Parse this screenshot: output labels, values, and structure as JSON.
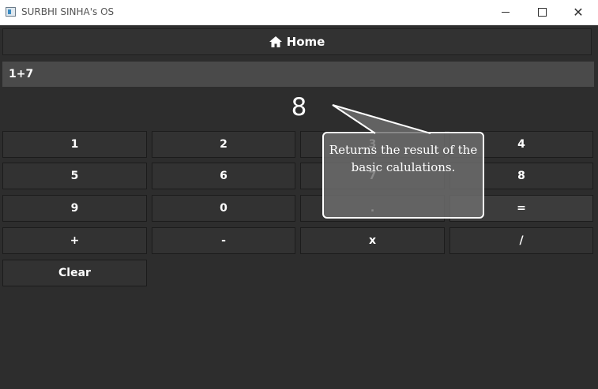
{
  "window": {
    "title": "SURBHI SINHA's OS"
  },
  "nav": {
    "home_label": "Home"
  },
  "display": {
    "expression": "1+7",
    "result": "8"
  },
  "keypad": {
    "k1": "1",
    "k2": "2",
    "k3": "3",
    "k4": "4",
    "k5": "5",
    "k6": "6",
    "k7": "7",
    "k8": "8",
    "k9": "9",
    "k0": "0",
    "dot": ".",
    "equals": "=",
    "plus": "+",
    "minus": "-",
    "multiply": "x",
    "divide": "/",
    "clear": "Clear"
  },
  "tooltip": {
    "text": "Returns the result of the basic calulations."
  },
  "icons": {
    "home": "home-icon",
    "app": "app-icon"
  },
  "colors": {
    "background": "#2d2d2d",
    "button": "#323232",
    "expression_bg": "#4a4a4a",
    "text": "#ffffff"
  }
}
